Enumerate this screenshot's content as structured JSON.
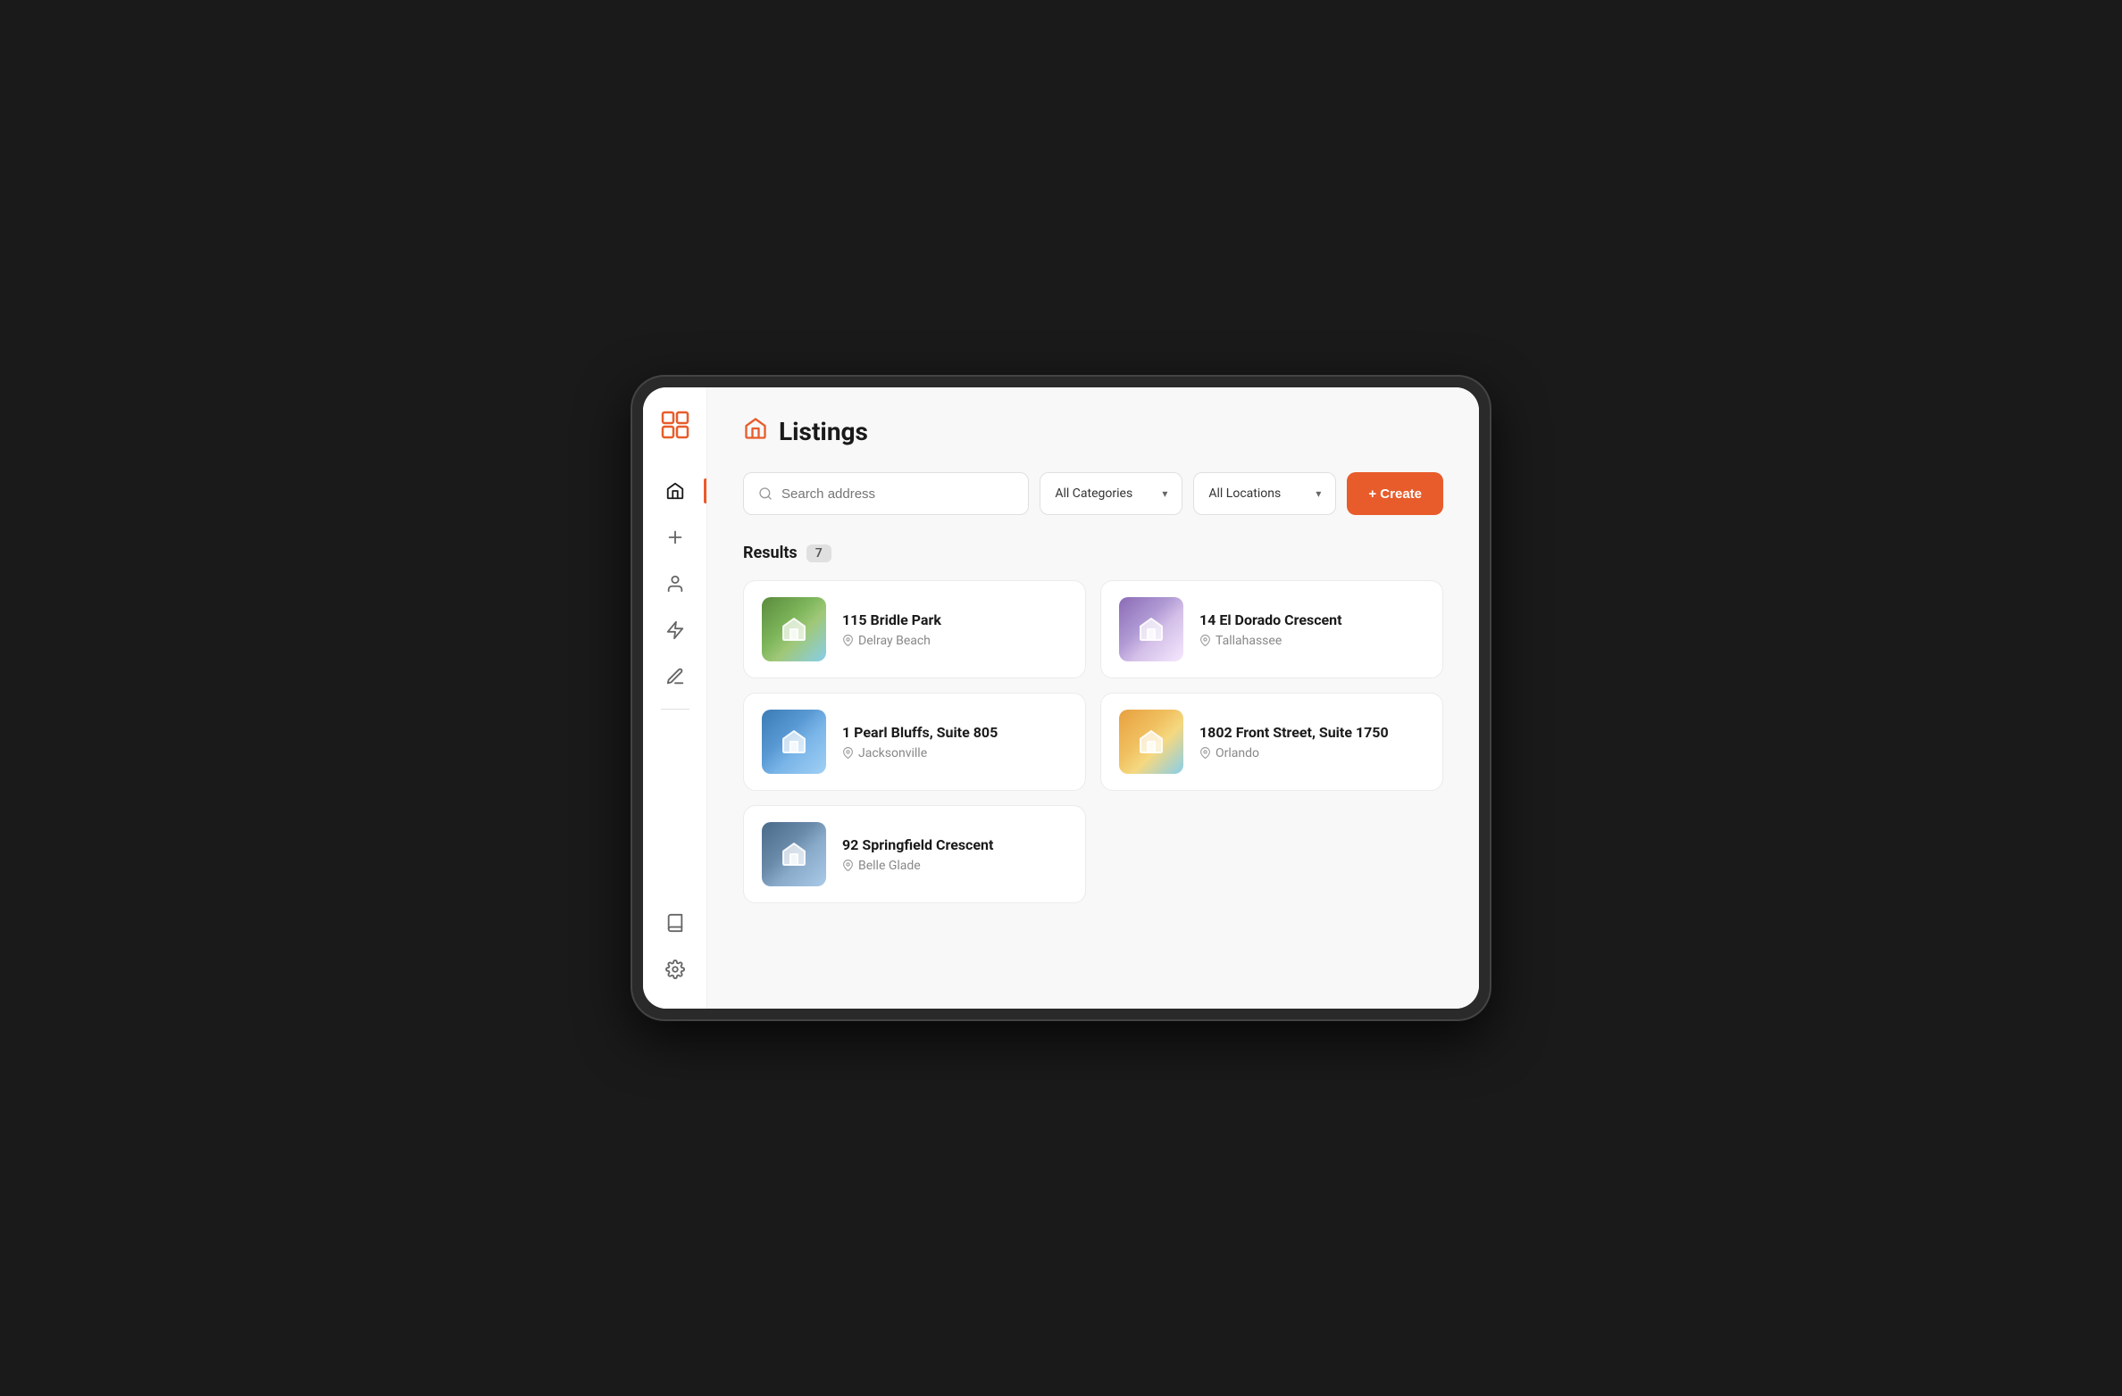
{
  "app": {
    "title": "Listings",
    "title_icon": "🏠"
  },
  "sidebar": {
    "logo_text": "⊡",
    "nav_items": [
      {
        "id": "home",
        "label": "Home",
        "active": true
      },
      {
        "id": "add",
        "label": "Add"
      },
      {
        "id": "profile",
        "label": "Profile"
      },
      {
        "id": "lightning",
        "label": "Activity"
      },
      {
        "id": "pen",
        "label": "Edit"
      }
    ],
    "bottom_items": [
      {
        "id": "book",
        "label": "Book"
      },
      {
        "id": "settings",
        "label": "Settings"
      }
    ]
  },
  "toolbar": {
    "search_placeholder": "Search address",
    "search_icon": "🔍",
    "categories_label": "All Categories",
    "locations_label": "All Locations",
    "create_label": "+ Create"
  },
  "results": {
    "label": "Results",
    "count": "7"
  },
  "listings": [
    {
      "id": 1,
      "name": "115 Bridle Park",
      "city": "Delray Beach",
      "thumb_class": "thumb-1"
    },
    {
      "id": 2,
      "name": "14 El Dorado Crescent",
      "city": "Tallahassee",
      "thumb_class": "thumb-2"
    },
    {
      "id": 3,
      "name": "1 Pearl Bluffs, Suite 805",
      "city": "Jacksonville",
      "thumb_class": "thumb-3"
    },
    {
      "id": 4,
      "name": "1802 Front Street, Suite 1750",
      "city": "Orlando",
      "thumb_class": "thumb-4"
    },
    {
      "id": 5,
      "name": "92 Springfield Crescent",
      "city": "Belle Glade",
      "thumb_class": "thumb-5"
    }
  ]
}
